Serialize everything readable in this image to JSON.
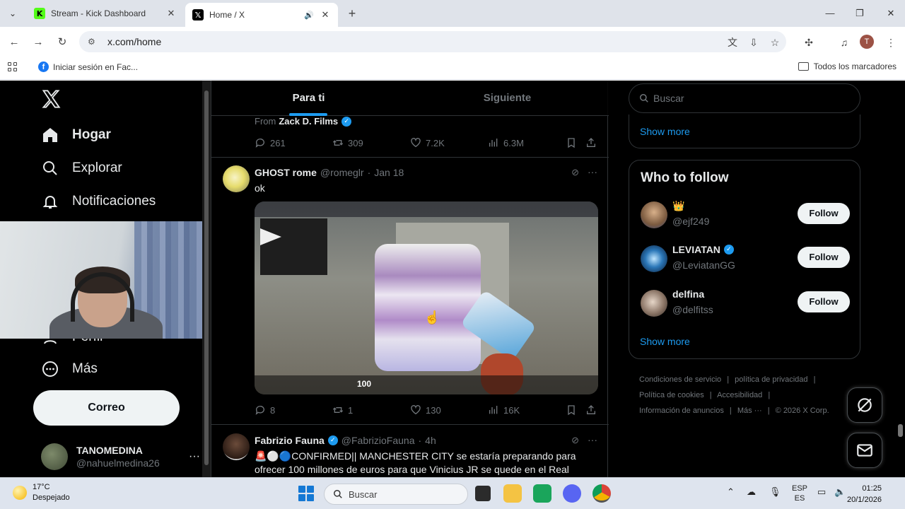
{
  "browser": {
    "tabs": [
      {
        "title": "Stream - Kick Dashboard",
        "favicon": "kick-icon",
        "color": "#53fc18"
      },
      {
        "title": "Home / X",
        "favicon": "x-icon",
        "active": true
      }
    ],
    "url": "x.com/home",
    "bookmarks": [
      {
        "label": "Iniciar sesión en Fac...",
        "icon": "facebook-icon"
      }
    ],
    "all_bookmarks_label": "Todos los marcadores",
    "profile_initial": "T"
  },
  "x": {
    "nav": [
      {
        "label": "Hogar",
        "icon": "home-icon",
        "active": true
      },
      {
        "label": "Explorar",
        "icon": "search-icon"
      },
      {
        "label": "Notificaciones",
        "icon": "bell-icon"
      },
      {
        "label": "Perfil",
        "icon": "user-icon"
      },
      {
        "label": "Más",
        "icon": "more-circle-icon"
      }
    ],
    "post_button": "Correo",
    "me": {
      "name": "TANOMEDINA",
      "handle": "@nahuelmedina26"
    },
    "feed_tabs": [
      "Para ti",
      "Siguiente"
    ],
    "prev_post": {
      "from_prefix": "From",
      "from_name": "Zack D. Films",
      "replies": "261",
      "reposts": "309",
      "likes": "7.2K",
      "views": "6.3M"
    },
    "post1": {
      "name": "GHOST rome",
      "handle": "@romeglr",
      "date": "Jan 18",
      "text": "ok",
      "media_hud_value": "100",
      "replies": "8",
      "reposts": "1",
      "likes": "130",
      "views": "16K"
    },
    "post2": {
      "name": "Fabrizio Fauna",
      "handle": "@FabrizioFauna",
      "date": "4h",
      "text": "🚨⚪🔵CONFIRMED|| MANCHESTER CITY se estaría preparando para ofrecer 100 millones de euros para que Vinicius JR se quede en el Real"
    },
    "search_placeholder": "Buscar",
    "show_more": "Show more",
    "who_to_follow": {
      "title": "Who to follow",
      "accounts": [
        {
          "name": "👑",
          "handle": "@ejf249",
          "verified": false,
          "button": "Follow"
        },
        {
          "name": "LEVIATAN",
          "handle": "@LeviatanGG",
          "verified": true,
          "button": "Follow"
        },
        {
          "name": "delfina",
          "handle": "@delfitss",
          "verified": false,
          "button": "Follow"
        }
      ],
      "show_more": "Show more"
    },
    "footer": {
      "line1": [
        "Condiciones de servicio",
        "|",
        "política de privacidad",
        "|"
      ],
      "line2": [
        "Política de cookies",
        "|",
        "Accesibilidad",
        "|"
      ],
      "line3": [
        "Información de anuncios",
        "|",
        "Más ···",
        "|",
        "© 2026 X Corp."
      ]
    }
  },
  "taskbar": {
    "temp": "17°C",
    "weather": "Despejado",
    "search": "Buscar",
    "lang1": "ESP",
    "lang2": "ES",
    "time": "01:25",
    "date": "20/1/2026"
  },
  "colors": {
    "x_blue": "#1d9bf0",
    "x_bg": "#000000"
  }
}
